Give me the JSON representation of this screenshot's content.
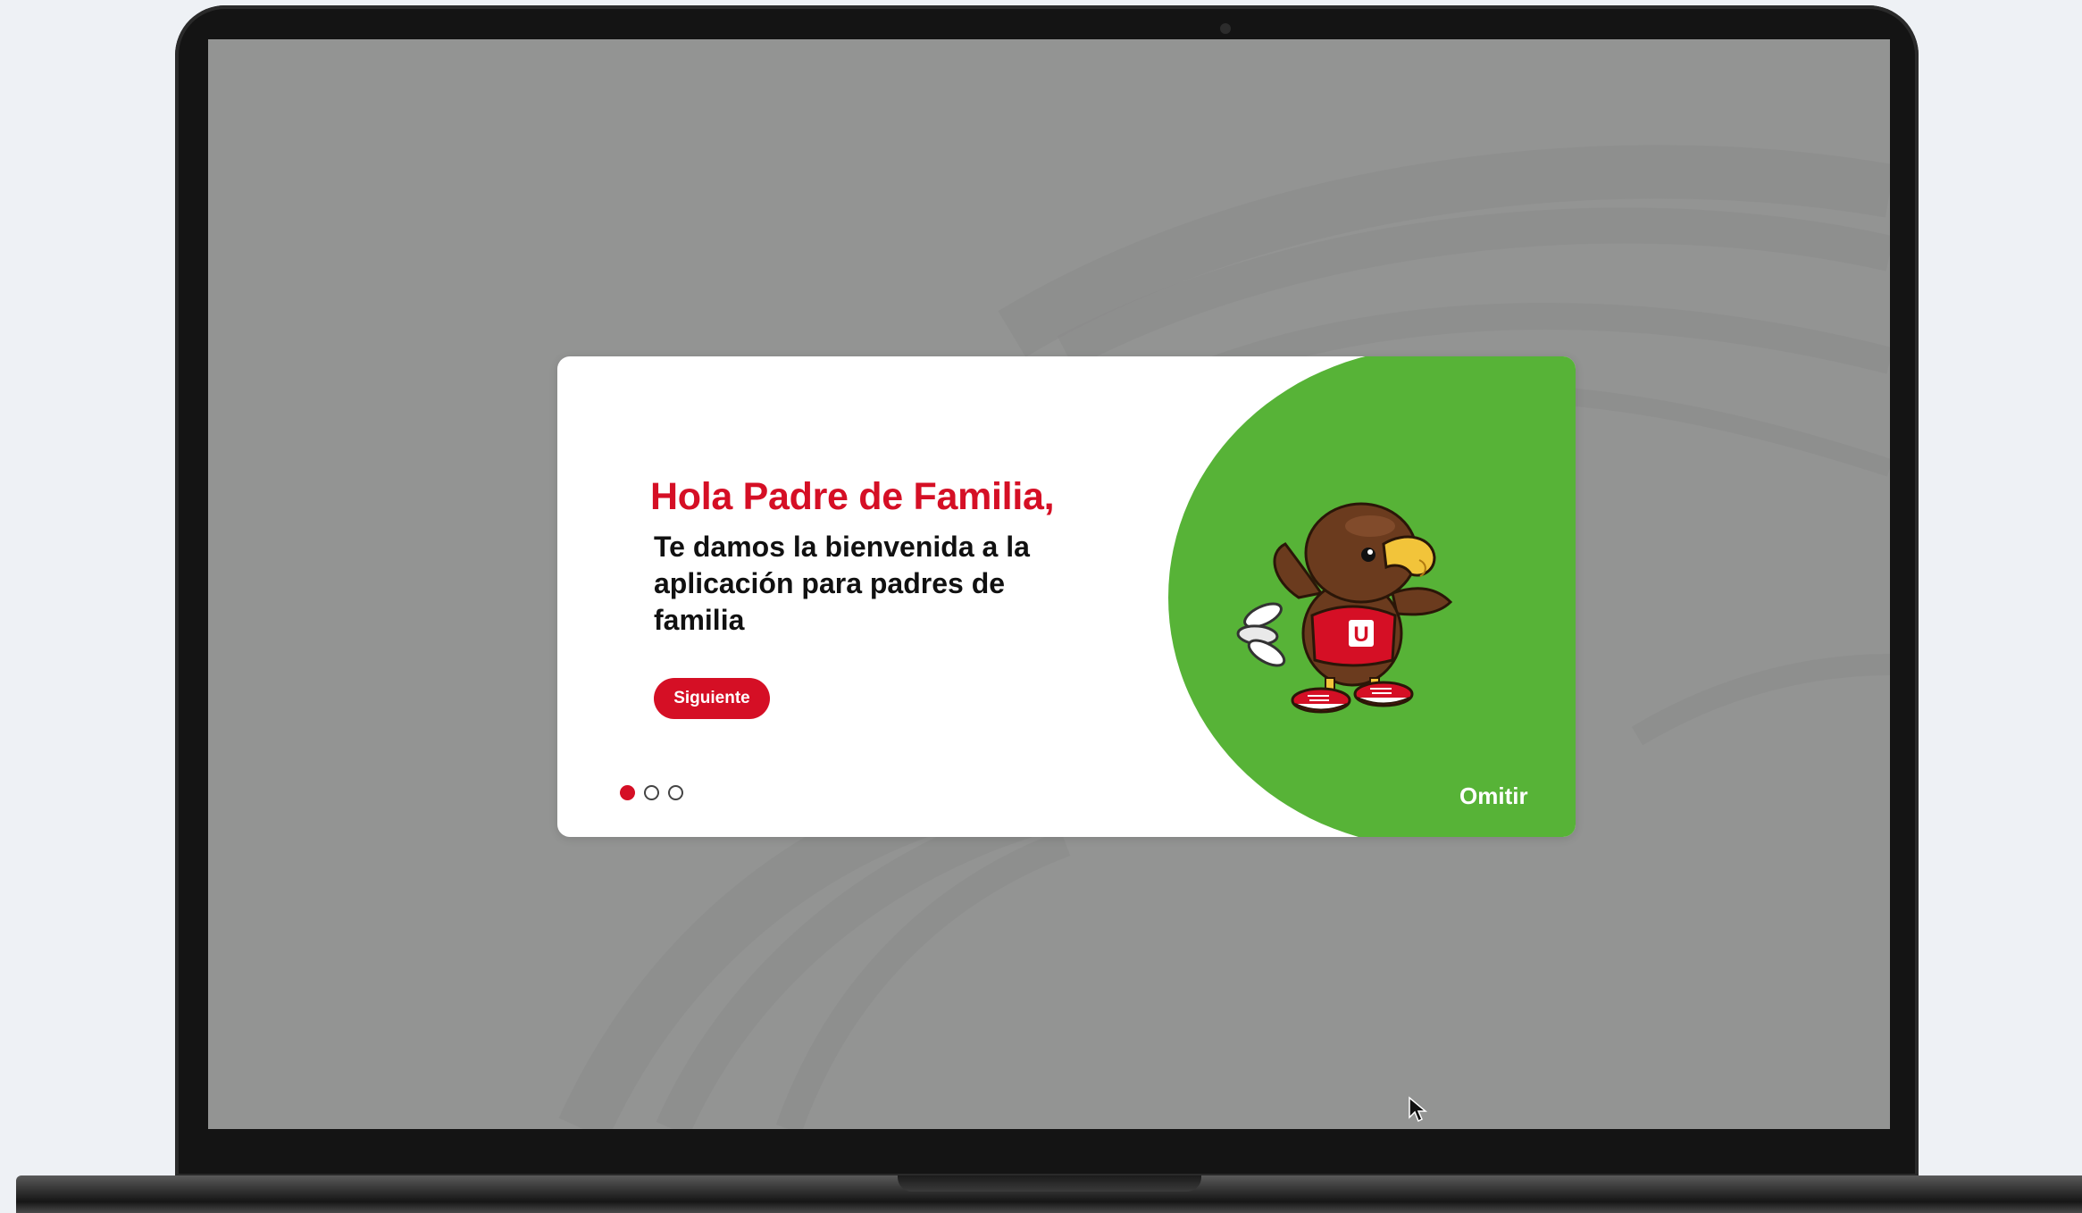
{
  "welcome_dialog": {
    "heading": "Hola Padre de Familia,",
    "subheading": "Te damos la bienvenida a la aplicación para padres de familia",
    "next_button_label": "Siguiente",
    "skip_label": "Omitir",
    "pagination": {
      "total": 3,
      "active": 1
    },
    "mascot": {
      "shirt_letter": "U",
      "icon": "eagle-mascot"
    }
  },
  "colors": {
    "brand_red": "#d50f25",
    "brand_green": "#57b337",
    "backdrop_gray": "#939493"
  }
}
